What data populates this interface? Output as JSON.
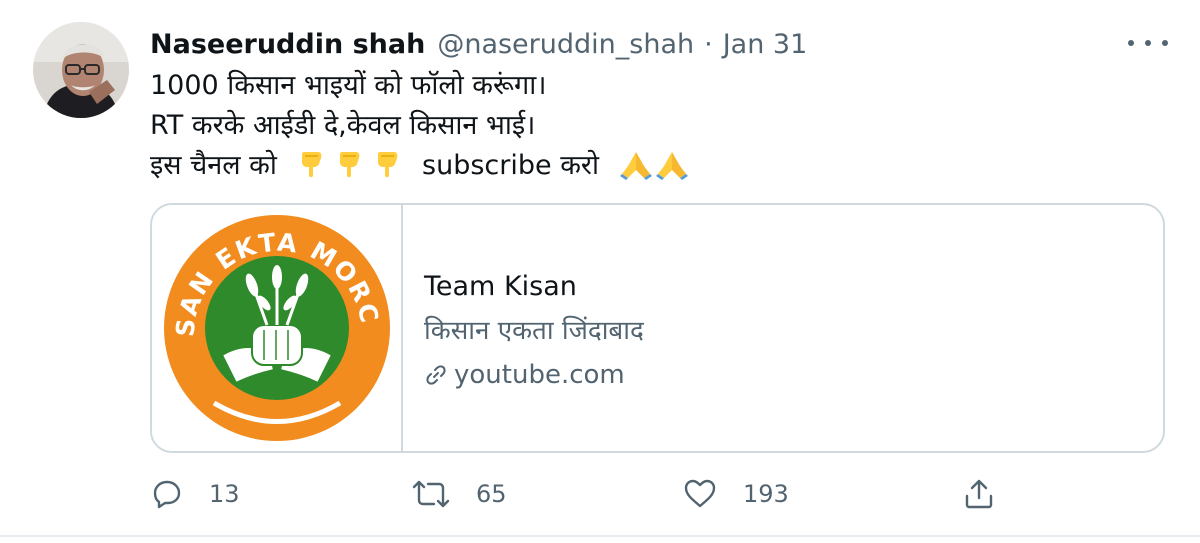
{
  "author": {
    "name": "Naseeruddin shah",
    "handle": "@naseruddin_shah",
    "separator": "·",
    "date": "Jan 31"
  },
  "tweet": {
    "line1": "1000 किसान भाइयों को फॉलो करूंगा।",
    "line2": "RT करके आईडी दे,केवल किसान भाई।",
    "line3_before": "इस चैनल को",
    "line3_after": "subscribe करो",
    "emoji_point": "point-down-emoji",
    "emoji_pray": "folded-hands-emoji"
  },
  "card": {
    "title": "Team Kisan",
    "description": "किसान एकता जिंदाबाद",
    "domain": "youtube.com",
    "logo_text": "KISAN EKTA MORCHA"
  },
  "actions": {
    "reply_count": "13",
    "retweet_count": "65",
    "like_count": "193"
  },
  "colors": {
    "text": "#0f1419",
    "secondary": "#536471",
    "border": "#cfd9de",
    "logo_orange": "#f28c1f",
    "logo_green": "#2f8a2c"
  }
}
